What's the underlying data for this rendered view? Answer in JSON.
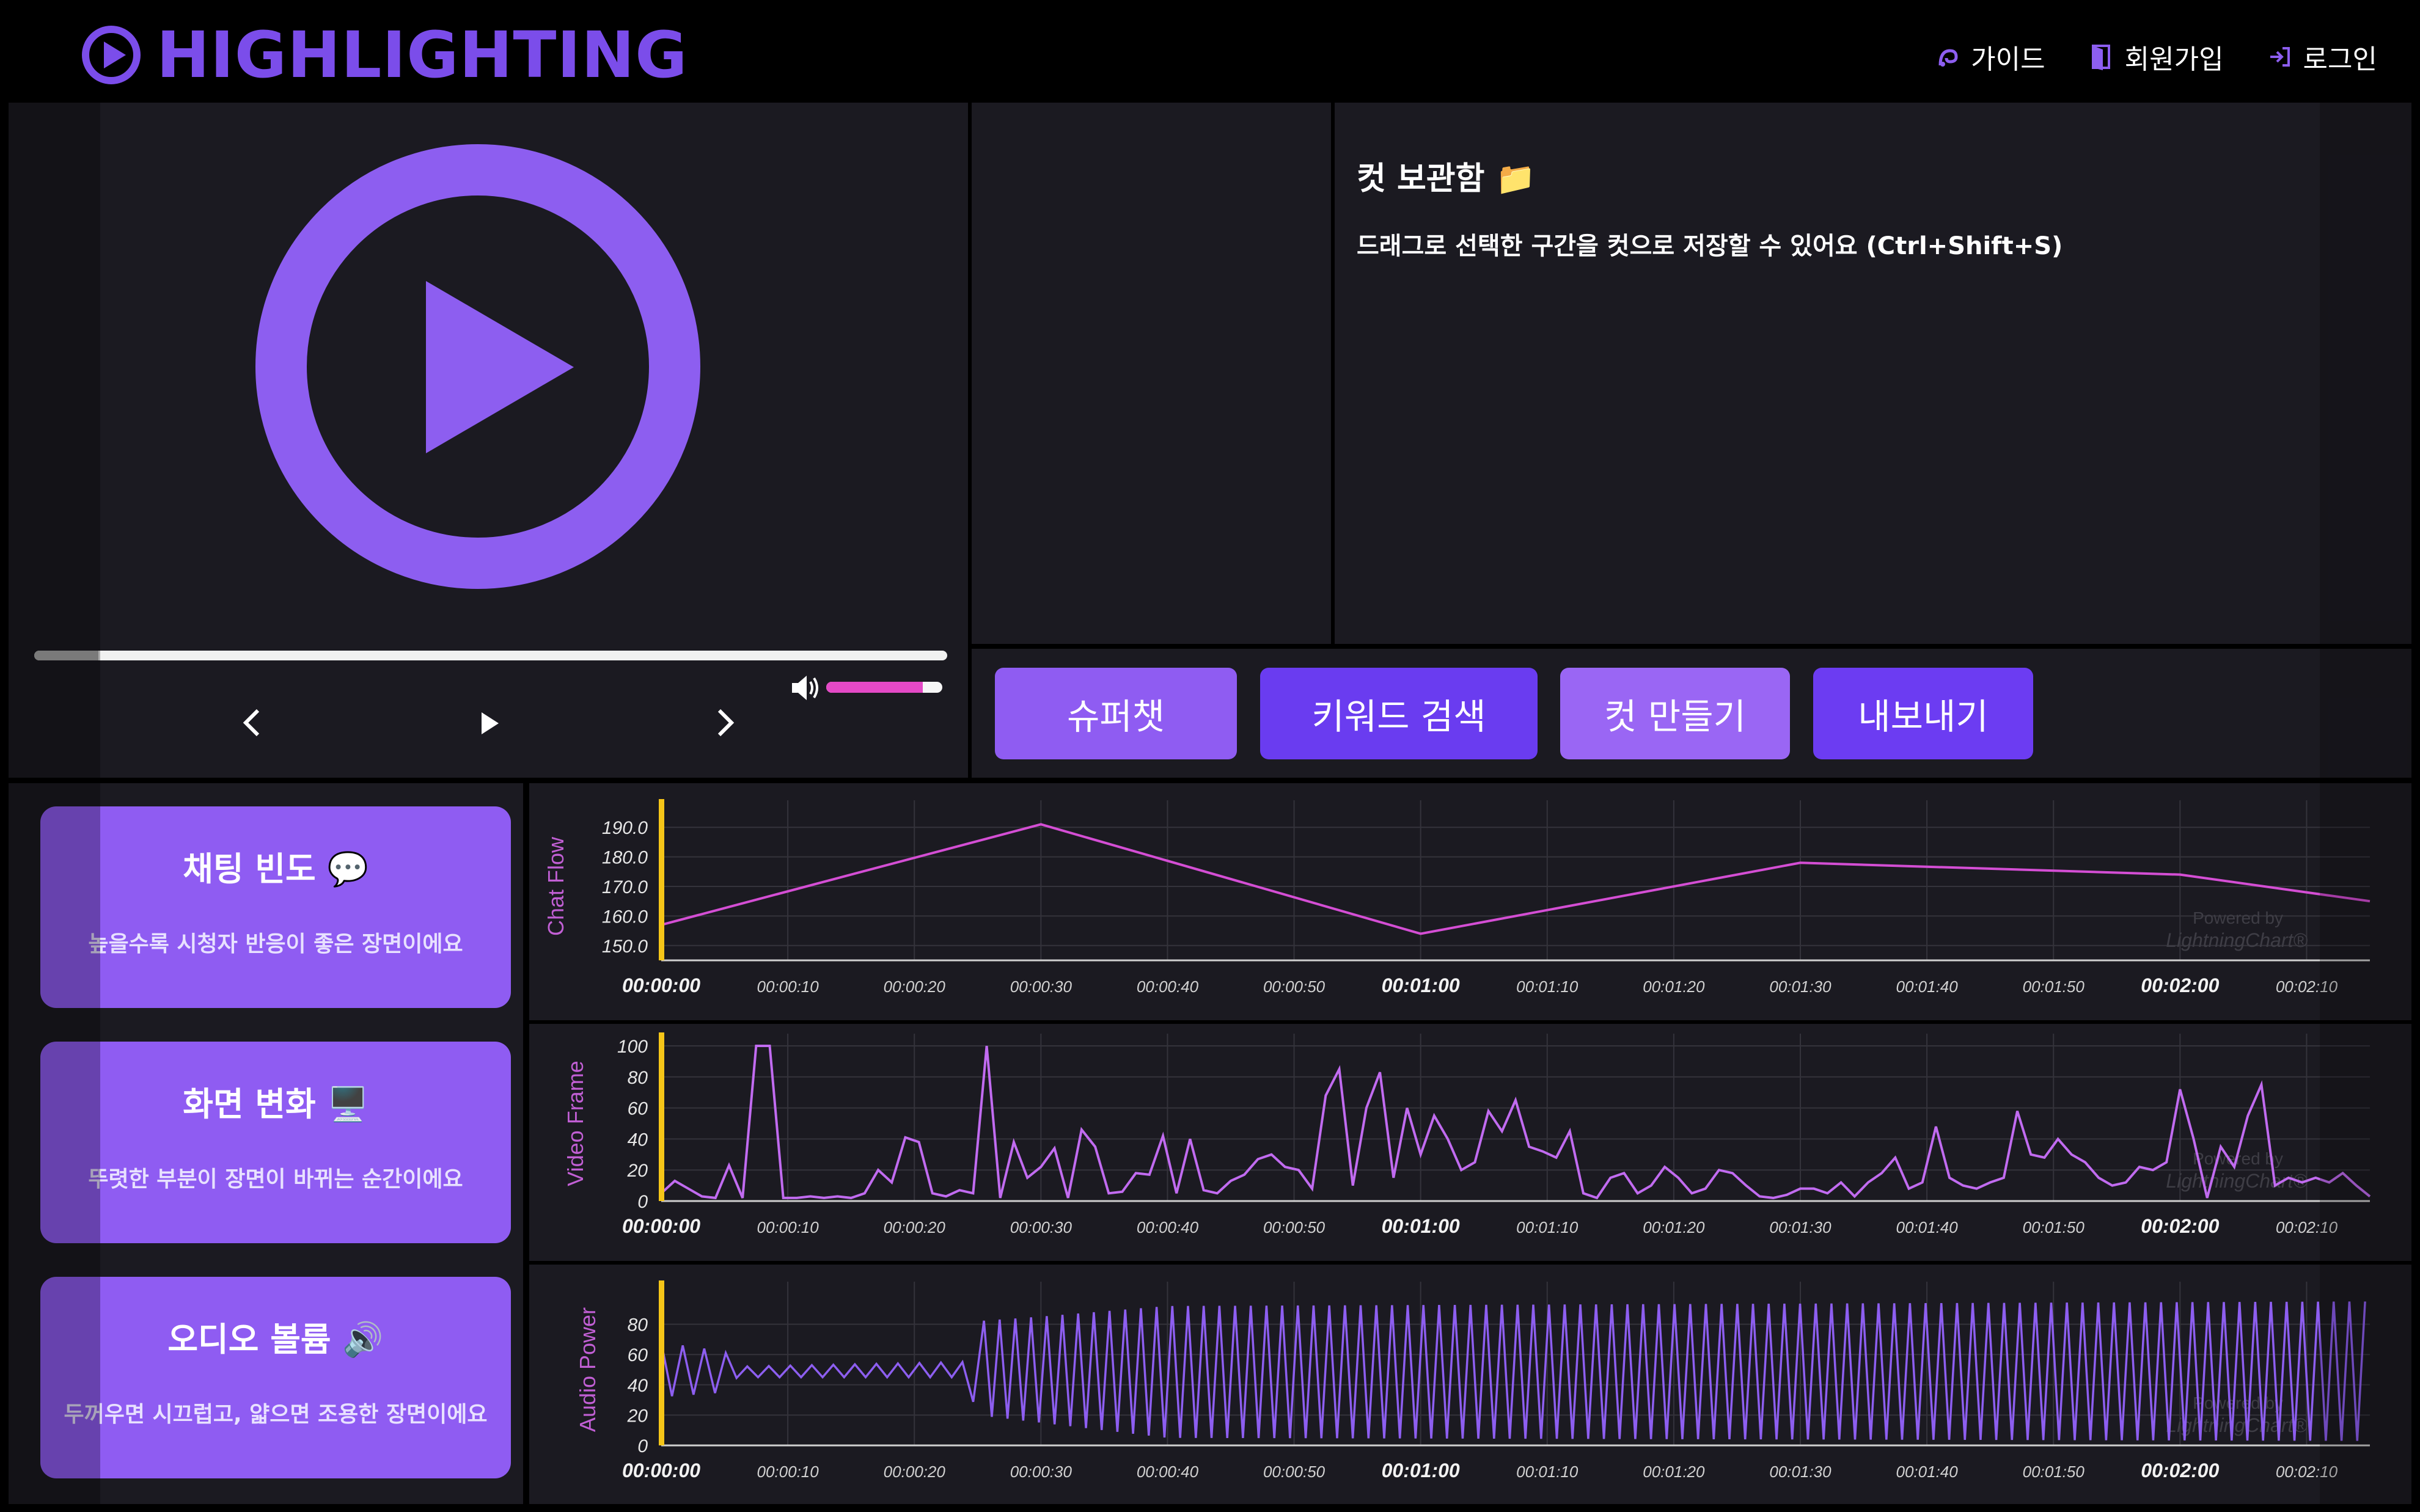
{
  "header": {
    "logo_text": "HIGHLIGHTING",
    "nav": [
      {
        "label": "가이드",
        "icon": "guide-icon"
      },
      {
        "label": "회원가입",
        "icon": "signup-door-icon"
      },
      {
        "label": "로그인",
        "icon": "login-icon"
      }
    ]
  },
  "player": {
    "progress": 0.07,
    "volume": 0.83,
    "icons": [
      "play-circle-icon",
      "chevron-left-icon",
      "play-icon",
      "chevron-right-icon",
      "volume-icon"
    ]
  },
  "cuts": {
    "title": "컷 보관함 📁",
    "description": "드래그로 선택한 구간을 컷으로 저장할 수 있어요 (Ctrl+Shift+S)"
  },
  "actions": {
    "superchat": "슈퍼챗",
    "keyword_search": "키워드 검색",
    "make_cut": "컷 만들기",
    "export": "내보내기"
  },
  "cards": [
    {
      "title": "채팅 빈도 💬",
      "desc": "높을수록 시청자 반응이 좋은 장면이에요"
    },
    {
      "title": "화면 변화 🖥️",
      "desc": "뚜렷한 부분이 장면이 바뀌는 순간이에요"
    },
    {
      "title": "오디오 볼륨 🔊",
      "desc": "두꺼우면 시끄럽고, 얇으면 조용한 장면이에요"
    }
  ],
  "colors": {
    "brand": "#7b4dea",
    "button_purple": "#8f5cf2",
    "button_deep": "#6a3cf0",
    "line_pink": "#d44ed4",
    "line_violet": "#c16bf0",
    "line_audio": "#8d5ef0",
    "marker_yellow": "#f5c518"
  },
  "chart_data": [
    {
      "type": "line",
      "ylabel": "Chat Flow",
      "ylim": [
        145,
        195
      ],
      "yticks": [
        "190.0",
        "180.0",
        "170.0",
        "160.0",
        "150.0"
      ],
      "xtick_labels": [
        "00:00:00",
        "00:00:10",
        "00:00:20",
        "00:00:30",
        "00:00:40",
        "00:00:50",
        "00:01:00",
        "00:01:10",
        "00:01:20",
        "00:01:30",
        "00:01:40",
        "00:01:50",
        "00:02:00",
        "00:02:10"
      ],
      "xlim": [
        0,
        135
      ],
      "x": [
        0,
        30,
        60,
        90,
        120,
        135
      ],
      "y": [
        157,
        191,
        154,
        178,
        174,
        165
      ],
      "watermark": [
        "Powered by",
        "LightningChart®"
      ]
    },
    {
      "type": "line",
      "ylabel": "Video Frame",
      "ylim": [
        0,
        100
      ],
      "yticks": [
        "100",
        "80",
        "60",
        "40",
        "20",
        "0"
      ],
      "xtick_labels": [
        "00:00:00",
        "00:00:10",
        "00:00:20",
        "00:00:30",
        "00:00:40",
        "00:00:50",
        "00:01:00",
        "00:01:10",
        "00:01:20",
        "00:01:30",
        "00:01:40",
        "00:01:50",
        "00:02:00",
        "00:02:10"
      ],
      "xlim": [
        0,
        135
      ],
      "y": [
        5,
        13,
        8,
        3,
        2,
        23,
        2,
        100,
        100,
        2,
        2,
        3,
        2,
        3,
        2,
        5,
        20,
        12,
        41,
        38,
        5,
        3,
        7,
        5,
        100,
        2,
        38,
        15,
        22,
        34,
        2,
        46,
        35,
        5,
        6,
        18,
        17,
        42,
        5,
        40,
        7,
        5,
        13,
        17,
        27,
        30,
        22,
        20,
        8,
        68,
        85,
        10,
        60,
        83,
        15,
        60,
        30,
        55,
        40,
        20,
        25,
        58,
        45,
        65,
        35,
        32,
        28,
        45,
        5,
        2,
        15,
        18,
        5,
        10,
        22,
        15,
        5,
        8,
        20,
        18,
        10,
        3,
        2,
        4,
        8,
        8,
        5,
        12,
        3,
        12,
        18,
        28,
        8,
        12,
        48,
        15,
        10,
        8,
        12,
        15,
        58,
        30,
        28,
        40,
        30,
        25,
        15,
        10,
        12,
        22,
        20,
        25,
        72,
        40,
        2,
        35,
        22,
        55,
        75,
        10,
        15,
        12,
        15,
        12,
        18,
        10,
        3
      ],
      "watermark": [
        "Powered by",
        "LightningChart®"
      ]
    },
    {
      "type": "line",
      "ylabel": "Audio Power",
      "ylim": [
        0,
        100
      ],
      "yticks": [
        "80",
        "60",
        "40",
        "20",
        "0"
      ],
      "xtick_labels": [
        "00:00:00",
        "00:00:10",
        "00:00:20",
        "00:00:30",
        "00:00:40",
        "00:00:50",
        "00:01:00",
        "00:01:10",
        "00:01:20",
        "00:01:30",
        "00:01:40",
        "00:01:50",
        "00:02:00",
        "00:02:10"
      ],
      "xlim": [
        0,
        135
      ],
      "envelope": [
        {
          "x": 0,
          "lo": 32,
          "hi": 68
        },
        {
          "x": 5,
          "lo": 35,
          "hi": 62
        },
        {
          "x": 6,
          "lo": 45,
          "hi": 52
        },
        {
          "x": 24,
          "lo": 45,
          "hi": 55
        },
        {
          "x": 25,
          "lo": 20,
          "hi": 82
        },
        {
          "x": 30,
          "lo": 15,
          "hi": 85
        },
        {
          "x": 40,
          "lo": 5,
          "hi": 92
        },
        {
          "x": 135,
          "lo": 3,
          "hi": 95
        }
      ],
      "watermark": [
        "Powered by",
        "LightningChart®"
      ]
    }
  ]
}
